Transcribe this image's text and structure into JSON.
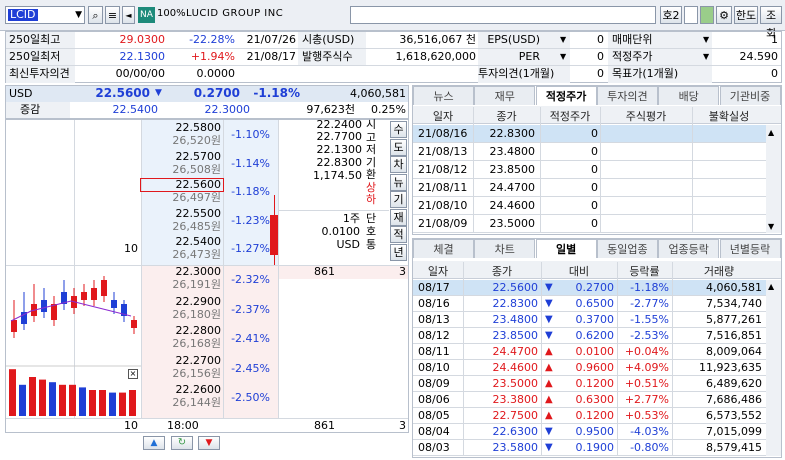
{
  "toolbar": {
    "code": "LCID",
    "market_badge": "NA",
    "ratio": "100%",
    "name": "LUCID GROUP INC",
    "slot_label": "호2",
    "btn_font": "한도",
    "btn_query": "조회"
  },
  "summary": {
    "rows": [
      {
        "l1": "250일최고",
        "v1": "29.0300",
        "p1": "-22.28%",
        "d1": "21/07/26",
        "l2": "시총(USD)",
        "v2": "36,516,067 천",
        "l3": "EPS(USD)",
        "v3": "0",
        "l4": "매매단위",
        "v4": "1"
      },
      {
        "l1": "250일최저",
        "v1": "22.1300",
        "p1": "+1.94%",
        "d1": "21/08/17",
        "l2": "발행주식수",
        "v2": "1,618,620,000",
        "l3": "PER",
        "v3": "0",
        "l4": "적정주가",
        "v4": "24.590"
      },
      {
        "l1": "최신투자의견",
        "v1": "00/00/00",
        "p1": "0.0000",
        "d1": "",
        "l2": "",
        "v2": "",
        "l3": "투자의견(1개월)",
        "v3": "0",
        "l4": "목표가(1개월)",
        "v4": "0"
      }
    ]
  },
  "quote": {
    "currency": "USD",
    "price": "22.5600",
    "change": "0.2700",
    "pct": "-1.18%",
    "volume": "4,060,581",
    "diff_label": "증감",
    "v1": "22.5400",
    "v2": "22.3000",
    "vol2": "97,623천",
    "pct2": "0.25%"
  },
  "orderbook": {
    "asks": [
      {
        "price": "22.5800",
        "won": "26,520원",
        "pct": "-1.10%"
      },
      {
        "price": "22.5700",
        "won": "26,508원",
        "pct": "-1.14%"
      },
      {
        "price": "22.5600",
        "won": "26,497원",
        "pct": "-1.18%"
      },
      {
        "price": "22.5500",
        "won": "26,485원",
        "pct": "-1.23%"
      },
      {
        "price": "22.5400",
        "won": "26,473원",
        "pct": "-1.27%",
        "qty": "10"
      }
    ],
    "bids": [
      {
        "price": "22.3000",
        "won": "26,191원",
        "pct": "-2.32%",
        "qty": "861",
        "right": "3"
      },
      {
        "price": "22.2900",
        "won": "26,180원",
        "pct": "-2.37%"
      },
      {
        "price": "22.2800",
        "won": "26,168원",
        "pct": "-2.41%"
      },
      {
        "price": "22.2700",
        "won": "26,156원",
        "pct": "-2.45%"
      },
      {
        "price": "22.2600",
        "won": "26,144원",
        "pct": "-2.50%"
      }
    ],
    "info": {
      "hi": "22.2400",
      "lo": "22.7700",
      "open": "22.1300",
      "close": "22.8300",
      "fx": "1,174.50",
      "labels": [
        "시",
        "고",
        "저",
        "기",
        "환",
        "상",
        "하"
      ],
      "unit": "1주",
      "tick": "0.0100",
      "cur": "USD",
      "unit_l": "단",
      "tick_l": "호",
      "cur_l": "통"
    },
    "side_btns": [
      "수",
      "도",
      "차",
      "뉴",
      "기",
      "재",
      "적",
      "년"
    ],
    "footer": {
      "qty": "10",
      "time": "18:00",
      "total": "861",
      "right": "3"
    }
  },
  "tabs_top": [
    "뉴스",
    "재무",
    "적정주가",
    "투자의견",
    "배당",
    "기관비중"
  ],
  "fair": {
    "headers": [
      "일자",
      "종가",
      "적정주가",
      "주식평가",
      "불확실성"
    ],
    "rows": [
      [
        "21/08/16",
        "22.8300",
        "0"
      ],
      [
        "21/08/13",
        "23.4800",
        "0"
      ],
      [
        "21/08/12",
        "23.8500",
        "0"
      ],
      [
        "21/08/11",
        "24.4700",
        "0"
      ],
      [
        "21/08/10",
        "24.4600",
        "0"
      ],
      [
        "21/08/09",
        "23.5000",
        "0"
      ]
    ]
  },
  "tabs_bot": [
    "체결",
    "차트",
    "일별",
    "동일업종",
    "업종등락",
    "년별등락"
  ],
  "daily": {
    "headers": [
      "일자",
      "종가",
      "대비",
      "등락률",
      "거래량"
    ],
    "rows": [
      [
        "08/17",
        "22.5600",
        "down",
        "0.2700",
        "-1.18%",
        "4,060,581"
      ],
      [
        "08/16",
        "22.8300",
        "down",
        "0.6500",
        "-2.77%",
        "7,534,740"
      ],
      [
        "08/13",
        "23.4800",
        "down",
        "0.3700",
        "-1.55%",
        "5,877,261"
      ],
      [
        "08/12",
        "23.8500",
        "down",
        "0.6200",
        "-2.53%",
        "7,516,851"
      ],
      [
        "08/11",
        "24.4700",
        "up",
        "0.0100",
        "+0.04%",
        "8,009,064"
      ],
      [
        "08/10",
        "24.4600",
        "up",
        "0.9600",
        "+4.09%",
        "11,923,635"
      ],
      [
        "08/09",
        "23.5000",
        "up",
        "0.1200",
        "+0.51%",
        "6,489,620"
      ],
      [
        "08/06",
        "23.3800",
        "up",
        "0.6300",
        "+2.77%",
        "7,686,486"
      ],
      [
        "08/05",
        "22.7500",
        "up",
        "0.1200",
        "+0.53%",
        "6,573,552"
      ],
      [
        "08/04",
        "22.6300",
        "down",
        "0.9500",
        "-4.03%",
        "7,015,099"
      ],
      [
        "08/03",
        "23.5800",
        "down",
        "0.1900",
        "-0.80%",
        "8,579,415"
      ]
    ]
  },
  "colors": {
    "up": "#e0181c",
    "down": "#1f3fd6",
    "accent": "#cfe3f5"
  }
}
